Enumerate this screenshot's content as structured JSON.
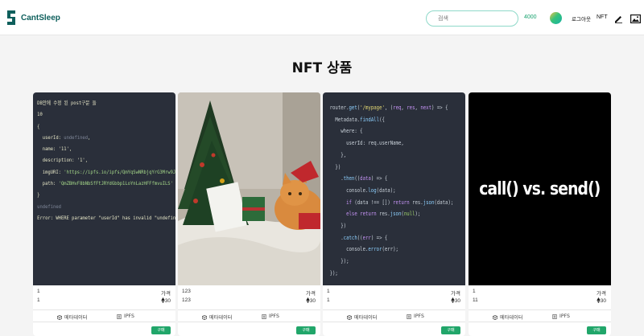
{
  "header": {
    "brand": "CantSleep",
    "search_placeholder": "검색",
    "balance": "4000",
    "logout": "로그아웃",
    "nft": "NFT",
    "icons": [
      "pen-icon",
      "image-icon"
    ]
  },
  "page": {
    "title": "NFT 상품"
  },
  "cards": [
    {
      "name": "1",
      "desc": "1",
      "price_label": "가격",
      "price": "30",
      "meta_label": "메타데이터",
      "ipfs_label": "IPFS",
      "buy_label": "구매"
    },
    {
      "name": "123",
      "desc": "123",
      "price_label": "가격",
      "price": "30",
      "meta_label": "메타데이터",
      "ipfs_label": "IPFS",
      "buy_label": "구매"
    },
    {
      "name": "1",
      "desc": "1",
      "price_label": "가격",
      "price": "30",
      "meta_label": "메타데이터",
      "ipfs_label": "IPFS",
      "buy_label": "구매"
    },
    {
      "name": "1",
      "desc": "11",
      "price_label": "가격",
      "price": "30",
      "meta_label": "메타데이터",
      "ipfs_label": "IPFS",
      "buy_label": "구매",
      "image_text": "call() vs. send()"
    }
  ],
  "colors": {
    "brand": "#0e5f5c",
    "accent": "#21a66a",
    "search_border": "#8fd9c9"
  }
}
